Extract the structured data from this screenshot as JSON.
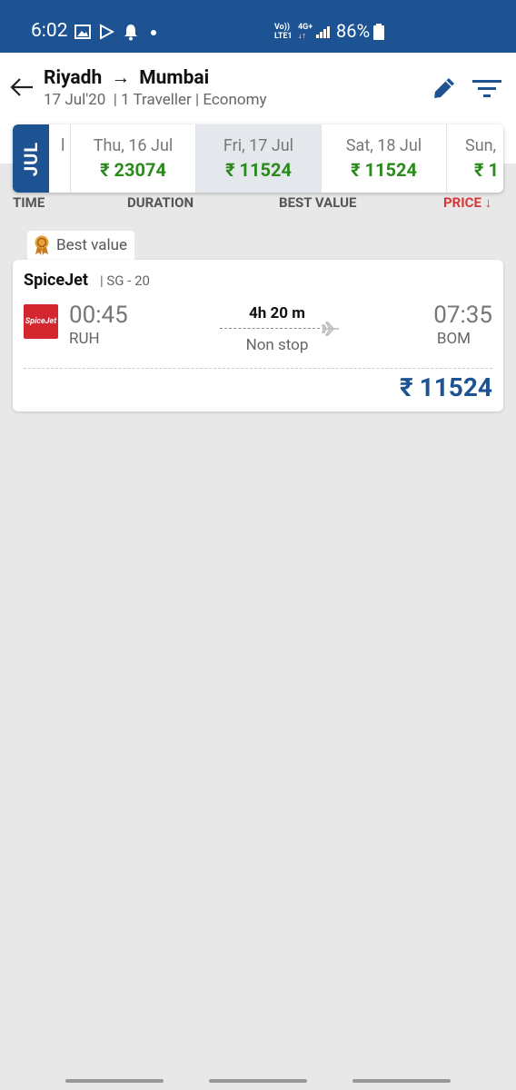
{
  "status_bar": {
    "time": "6:02",
    "network_top": "Vo))",
    "network_bottom": "LTE1",
    "signal_top": "4G+",
    "battery": "86%",
    "background_color": "#1d5393"
  },
  "header": {
    "origin": "Riyadh",
    "destination": "Mumbai",
    "arrow": "→",
    "date": "17 Jul'20",
    "details": "| 1 Traveller | Economy"
  },
  "date_strip": {
    "month": "JUL",
    "prev_partial": "l",
    "days": [
      {
        "label": "Thu, 16 Jul",
        "price": "₹ 23074"
      },
      {
        "label": "Fri, 17 Jul",
        "price": "₹ 11524",
        "selected": true
      },
      {
        "label": "Sat, 18 Jul",
        "price": "₹ 11524"
      },
      {
        "label": "Sun,",
        "price": "₹ 1"
      }
    ]
  },
  "sort": {
    "time": "TIME",
    "duration": "DURATION",
    "best_value": "BEST VALUE",
    "price": "PRICE",
    "price_arrow": "↓"
  },
  "badge": {
    "label": "Best value"
  },
  "flight": {
    "airline": "SpiceJet",
    "flight_no": "| SG - 20",
    "logo_text": "SpiceJet",
    "departure_time": "00:45",
    "departure_code": "RUH",
    "duration": "4h 20 m",
    "stops": "Non stop",
    "arrival_time": "07:35",
    "arrival_code": "BOM",
    "price": "₹ 11524"
  },
  "colors": {
    "brand": "#1d5393",
    "price_green": "#2a8a1c",
    "sort_active": "#d63838"
  }
}
